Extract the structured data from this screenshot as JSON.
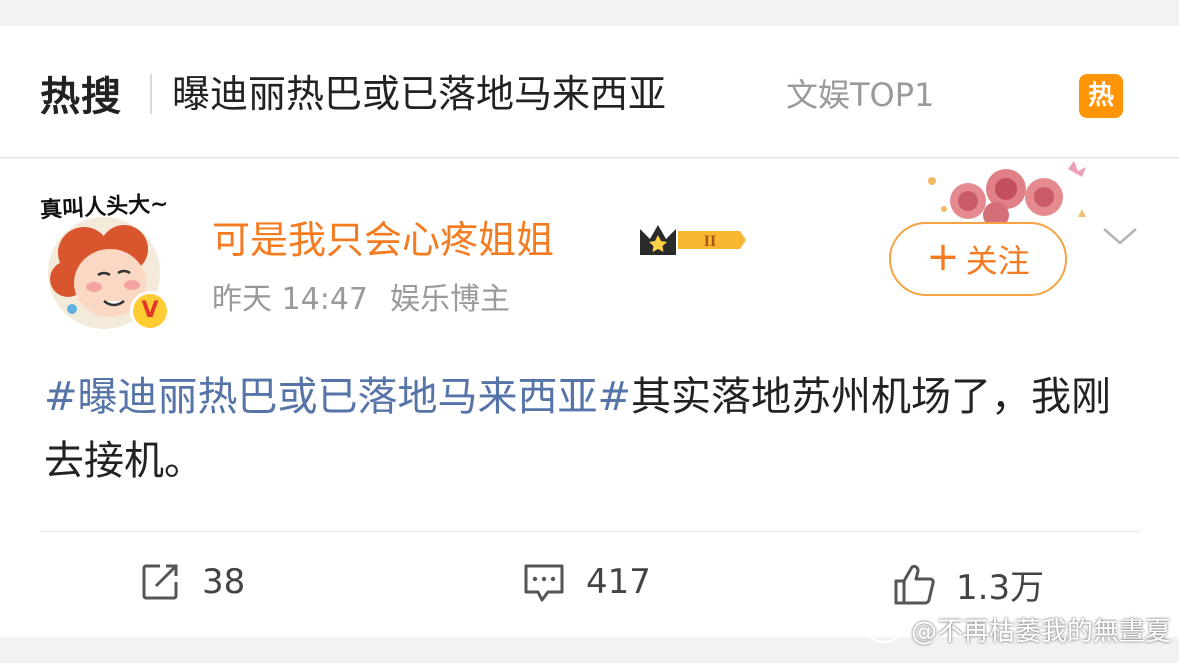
{
  "hot_search": {
    "logo_label": "热搜",
    "title": "曝迪丽热巴或已落地马来西亚",
    "rank_label": "文娱TOP1",
    "badge": "热"
  },
  "post": {
    "avatar_caption": "真叫人头大~",
    "verified_icon": "V",
    "username": "可是我只会心疼姐姐",
    "member_level": "II",
    "time": "昨天 14:47",
    "source": "娱乐博主",
    "follow_label": "关注",
    "follow_plus": "+",
    "content": {
      "hashtag": "#曝迪丽热巴或已落地马来西亚#",
      "text": "其实落地苏州机场了，我刚去接机。"
    }
  },
  "actions": {
    "repost_count": "38",
    "comment_count": "417",
    "like_count": "1.3万"
  },
  "watermark": "@不再枯萎我的無晝夏",
  "colors": {
    "accent_orange": "#f47b20",
    "hashtag_blue": "#5674a8",
    "hot_badge": "#ff9406"
  }
}
